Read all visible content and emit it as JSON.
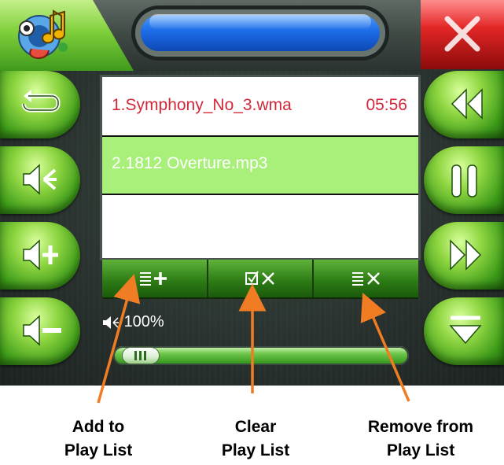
{
  "playlist": {
    "items": [
      {
        "title": "1.Symphony_No_3.wma",
        "duration": "05:56"
      },
      {
        "title": "2.1812 Overture.mp3",
        "duration": ""
      }
    ]
  },
  "volume": {
    "percent_label": "100%"
  },
  "seek": {
    "progress_fraction": 0.03
  },
  "toolbar": {
    "add_icon": "playlist-add-icon",
    "clear_icon": "checkbox-clear-icon",
    "remove_icon": "playlist-remove-icon"
  },
  "side_buttons": {
    "left": [
      "repeat-icon",
      "mute-icon",
      "volume-up-icon",
      "volume-down-icon"
    ],
    "right": [
      "rewind-icon",
      "pause-icon",
      "fast-forward-icon",
      "menu-down-icon"
    ]
  },
  "callouts": {
    "add": {
      "line1": "Add to",
      "line2": "Play List"
    },
    "clear": {
      "line1": "Clear",
      "line2": "Play List"
    },
    "remove": {
      "line1": "Remove from",
      "line2": "Play List"
    }
  },
  "colors": {
    "accent_green": "#6fc43a",
    "title_blue": "#1d6de8",
    "close_red": "#e32626",
    "selected_row": "#a9f07a",
    "active_text": "#d2283a",
    "arrow_orange": "#f07c24"
  }
}
